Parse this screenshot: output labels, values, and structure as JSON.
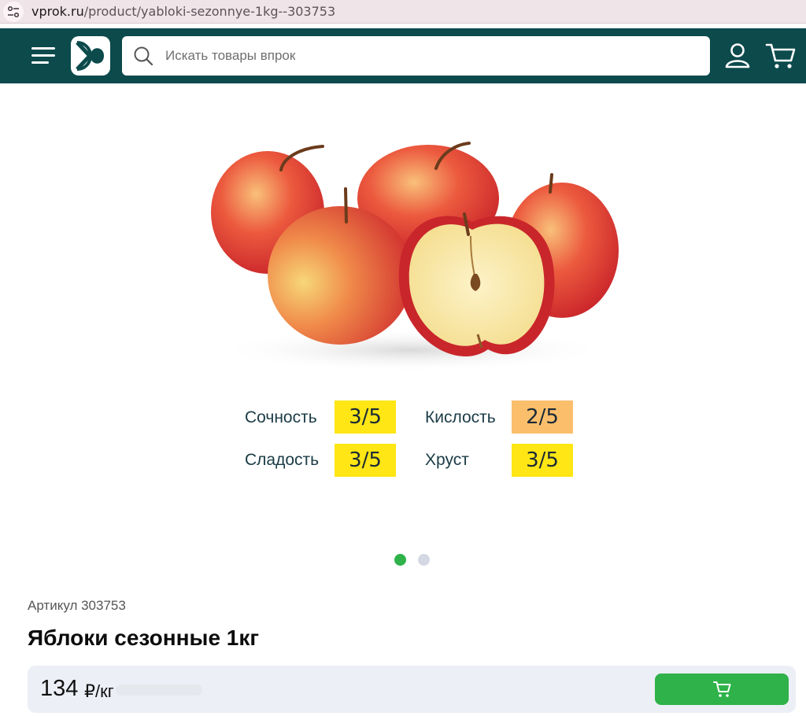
{
  "browser": {
    "url_domain": "vprok.ru",
    "url_path": "/product/yabloki-sezonnye-1kg--303753"
  },
  "header": {
    "search_placeholder": "Искать товары впрок",
    "icons": [
      "menu-icon",
      "logo-icon",
      "search-icon",
      "user-icon",
      "cart-icon"
    ],
    "background_color": "#0c4a4c"
  },
  "characteristics": [
    {
      "label": "Сочность",
      "value": "3/5",
      "color": "#ffe614"
    },
    {
      "label": "Кислость",
      "value": "2/5",
      "color": "#fbbf6c"
    },
    {
      "label": "Сладость",
      "value": "3/5",
      "color": "#ffe614"
    },
    {
      "label": "Хруст",
      "value": "3/5",
      "color": "#ffe614"
    }
  ],
  "gallery": {
    "active_index": 0,
    "total": 2,
    "active_color": "#2eb249",
    "inactive_color": "#d3d8e3"
  },
  "product": {
    "sku": "Артикул 303753",
    "title": "Яблоки сезонные 1кг",
    "price": "134",
    "price_unit": "₽/кг"
  },
  "actions": {
    "add_to_cart_color": "#2eb249"
  }
}
